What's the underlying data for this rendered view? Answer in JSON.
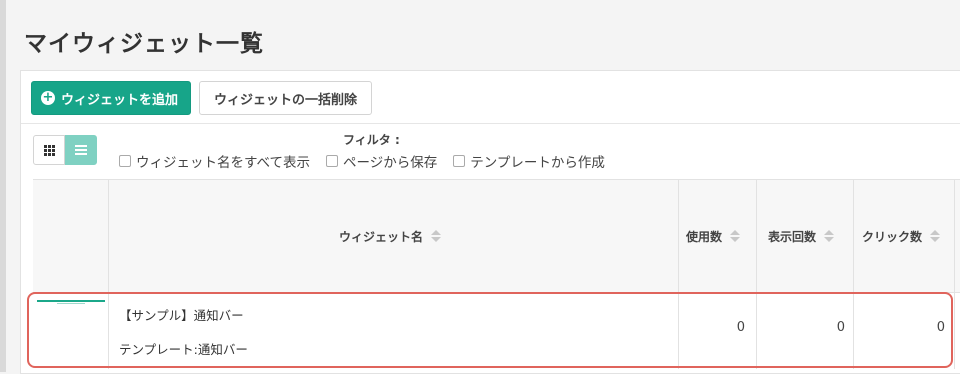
{
  "page": {
    "title": "マイウィジェット一覧"
  },
  "toolbar": {
    "add_button": "ウィジェットを追加",
    "bulk_delete_button": "ウィジェットの一括削除"
  },
  "filter": {
    "label": "フィルタ :",
    "options": [
      {
        "label": "ウィジェット名をすべて表示",
        "checked": false
      },
      {
        "label": "ページから保存",
        "checked": false
      },
      {
        "label": "テンプレートから作成",
        "checked": false
      }
    ]
  },
  "table": {
    "headers": [
      "ウィジェット名",
      "使用数",
      "表示回数",
      "クリック数"
    ],
    "rows": [
      {
        "name": "【サンプル】通知バー",
        "template": "テンプレート:通知バー",
        "usage": "0",
        "views": "0",
        "clicks": "0"
      }
    ]
  },
  "colors": {
    "accent": "#17a589",
    "highlight": "#e0645c"
  }
}
